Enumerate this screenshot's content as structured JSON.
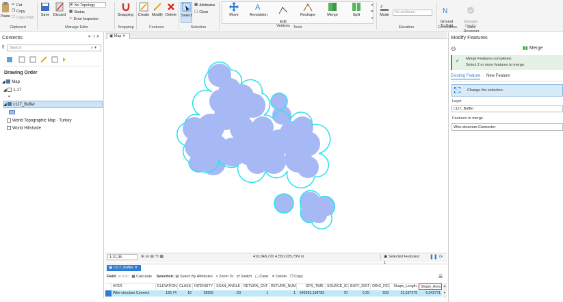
{
  "ribbon": {
    "clipboard": {
      "paste": "Paste",
      "cut": "Cut",
      "copy": "Copy",
      "copy_path": "Copy Path",
      "label": "Clipboard"
    },
    "manage_edits": {
      "save": "Save",
      "discard": "Discard",
      "topology": "No Topology",
      "status": "Status",
      "error_inspector": "Error Inspector",
      "label": "Manage Edits"
    },
    "snapping": {
      "button": "Snapping",
      "label": "Snapping"
    },
    "features": {
      "create": "Create",
      "modify": "Modify",
      "delete": "Delete",
      "label": "Features"
    },
    "selection": {
      "select": "Select",
      "attributes": "Attributes",
      "clear": "Clear",
      "label": "Selection"
    },
    "tools": {
      "move": "Move",
      "annotation": "Annotation",
      "edit_vertices": "Edit\nVertices",
      "reshape": "Reshape",
      "merge": "Merge",
      "split": "Split",
      "label": "Tools"
    },
    "elevation": {
      "mode": "Mode",
      "surface": "No surfaces",
      "label": "Elevation"
    },
    "corrections": {
      "ground_to_grid": "Ground\nTo Grid",
      "manage_quality": "Manage\nQuality",
      "label": "Corrections",
      "data_reviewer": "Data Reviewer"
    }
  },
  "contents": {
    "title": "Contents",
    "search_placeholder": "Search",
    "drawing_order": "Drawing Order",
    "map": "Map",
    "layer_117": "1-17",
    "layer_buffer": "c117_Buffer",
    "basemap1": "World Topographic Map - Turkey",
    "basemap2": "World Hillshade"
  },
  "map_tab": {
    "label": "Map"
  },
  "status_bar": {
    "scale": "1:31,35",
    "coords": "410,848,720 4,550,205,79N m",
    "selected": "Selected Features: 1"
  },
  "table": {
    "tab": "c117_Buffer",
    "toolbar": {
      "field": "Field:",
      "add": "Add",
      "calculate": "Calculate",
      "selection": "Selection:",
      "select_by_attributes": "Select By Attributes",
      "zoom_to": "Zoom To",
      "switch": "Switch",
      "clear": "Clear",
      "delete": "Delete",
      "copy": "Copy"
    },
    "columns": [
      "AYER",
      "ELEVATION",
      "CLASS",
      "INTENSITY",
      "SCAN_ANGLE",
      "RETURN_CNT",
      "RETURN_NUM",
      "GPS_TIME",
      "SOURCE_ID",
      "BUFF_DIST",
      "ORIG_FID",
      "Shape_Length",
      "Shape_Area"
    ],
    "row": [
      "Wire-structure Connect",
      "136,74",
      "16",
      "65505",
      "-23",
      "1",
      "1",
      "543393,168783",
      "70",
      "0,25",
      "503",
      "21,597379",
      "6,342771"
    ]
  },
  "modify": {
    "title": "Modify Features",
    "tool": "Merge",
    "msg1": "Merge Features completed.",
    "msg2": "Select 2 or more features to merge.",
    "tab_existing": "Existing Feature",
    "tab_new": "New Feature",
    "change_selection": "Change the selection.",
    "layer_label": "Layer",
    "layer_value": "c117_Buffer",
    "features_label": "Features to merge",
    "feature_item": "Wire-structure Connector"
  },
  "colors": {
    "polygon_fill": "#a7b9f5",
    "polygon_outline": "#33e0ee",
    "accent": "#2d7dd2",
    "ribbon_bg": "#f4f4f4"
  }
}
